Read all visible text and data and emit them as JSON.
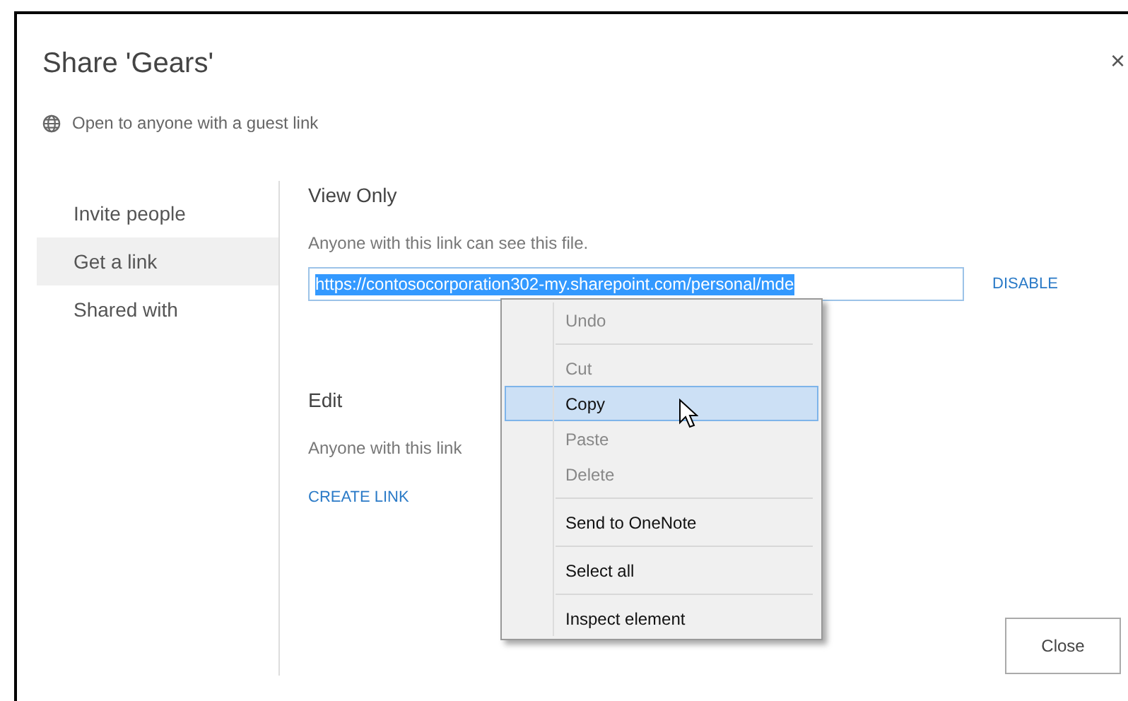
{
  "dialog": {
    "title": "Share 'Gears'",
    "close_icon": "×",
    "access_note": "Open to anyone with a guest link"
  },
  "nav": [
    {
      "label": "Invite people",
      "selected": false
    },
    {
      "label": "Get a link",
      "selected": true
    },
    {
      "label": "Shared with",
      "selected": false
    }
  ],
  "sections": [
    {
      "title": "View Only",
      "description": "Anyone with this link can see this file.",
      "link_value": "https://contosocorporation302-my.sharepoint.com/personal/mde",
      "action": "DISABLE"
    },
    {
      "title": "Edit",
      "description": "Anyone with this link",
      "action": "CREATE LINK"
    }
  ],
  "context_menu": {
    "groups": [
      [
        {
          "label": "Undo",
          "disabled": true,
          "selected": false
        }
      ],
      [
        {
          "label": "Cut",
          "disabled": true,
          "selected": false
        },
        {
          "label": "Copy",
          "disabled": false,
          "selected": true
        },
        {
          "label": "Paste",
          "disabled": true,
          "selected": false
        },
        {
          "label": "Delete",
          "disabled": true,
          "selected": false
        }
      ],
      [
        {
          "label": "Send to OneNote",
          "disabled": false,
          "selected": false
        }
      ],
      [
        {
          "label": "Select all",
          "disabled": false,
          "selected": false
        }
      ],
      [
        {
          "label": "Inspect element",
          "disabled": false,
          "selected": false
        }
      ]
    ]
  },
  "footer": {
    "close_button": "Close"
  }
}
